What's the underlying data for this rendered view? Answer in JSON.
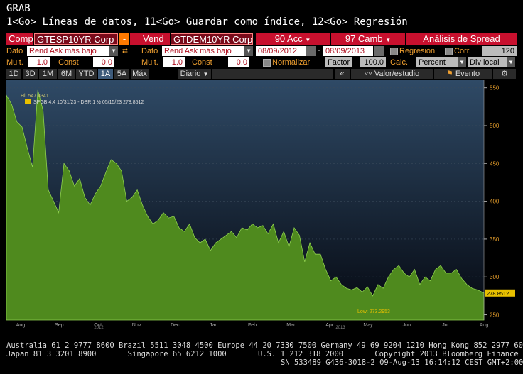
{
  "header": {
    "title": "GRAB",
    "commands": "1<Go> Líneas de datos, 11<Go> Guardar como índice, 12<Go> Regresión"
  },
  "toolbar": {
    "comp_label": "Comp",
    "comp_ticker": "GTESP10YR Corp",
    "minus": "-",
    "vend_label": "Vend",
    "vend_ticker": "GTDEM10YR Corp",
    "acc_label": "90 Acc",
    "camb_label": "97 Camb",
    "analysis_label": "Análisis de Spread"
  },
  "params": {
    "dato_label_1": "Dato",
    "dato_value_1": "Rend Ask más bajo",
    "dato_label_2": "Dato",
    "dato_value_2": "Rend Ask más bajo",
    "date_start": "08/09/2012",
    "date_end": "08/09/2013",
    "regresion": "Regresión",
    "corr": "Corr.",
    "corr_value": "120",
    "mult_label_1": "Mult.",
    "mult_value_1": "1.0",
    "const_label_1": "Const",
    "const_value_1": "0.0",
    "mult_label_2": "Mult.",
    "mult_value_2": "1.0",
    "const_label_2": "Const",
    "const_value_2": "0.0",
    "normalizar": "Normalizar",
    "factor_label": "Factor",
    "factor_value": "100.0",
    "calc_label": "Calc.",
    "calc_value": "Percent",
    "div_value": "Div local"
  },
  "tabs": {
    "items": [
      "1D",
      "3D",
      "1M",
      "6M",
      "YTD",
      "1A",
      "5A",
      "Máx"
    ],
    "active": "1A",
    "period": "Diario",
    "collapse": "«",
    "study": "Valor/estudio",
    "event": "Evento",
    "gear": "gear-icon"
  },
  "chart_data": {
    "type": "area",
    "series": [
      {
        "legend": "SPGB 4.4 10/31/23 - DBR 1 ½ 05/15/23 278.8512",
        "color": "#4f8a1e",
        "x": [
          "2012-08-09",
          "2012-08-13",
          "2012-08-17",
          "2012-08-21",
          "2012-08-25",
          "2012-08-29",
          "2012-09-02",
          "2012-09-06",
          "2012-09-10",
          "2012-09-14",
          "2012-09-18",
          "2012-09-22",
          "2012-09-26",
          "2012-09-30",
          "2012-10-04",
          "2012-10-08",
          "2012-10-12",
          "2012-10-16",
          "2012-10-20",
          "2012-10-24",
          "2012-10-28",
          "2012-11-01",
          "2012-11-05",
          "2012-11-09",
          "2012-11-13",
          "2012-11-17",
          "2012-11-21",
          "2012-11-25",
          "2012-11-29",
          "2012-12-03",
          "2012-12-07",
          "2012-12-11",
          "2012-12-15",
          "2012-12-19",
          "2012-12-23",
          "2012-12-27",
          "2012-12-31",
          "2013-01-04",
          "2013-01-08",
          "2013-01-12",
          "2013-01-16",
          "2013-01-20",
          "2013-01-24",
          "2013-01-28",
          "2013-02-01",
          "2013-02-05",
          "2013-02-09",
          "2013-02-13",
          "2013-02-17",
          "2013-02-21",
          "2013-02-25",
          "2013-03-01",
          "2013-03-05",
          "2013-03-09",
          "2013-03-13",
          "2013-03-17",
          "2013-03-21",
          "2013-03-25",
          "2013-03-29",
          "2013-04-02",
          "2013-04-06",
          "2013-04-10",
          "2013-04-14",
          "2013-04-18",
          "2013-04-22",
          "2013-04-26",
          "2013-04-30",
          "2013-05-04",
          "2013-05-08",
          "2013-05-12",
          "2013-05-16",
          "2013-05-20",
          "2013-05-24",
          "2013-05-28",
          "2013-06-01",
          "2013-06-05",
          "2013-06-09",
          "2013-06-13",
          "2013-06-17",
          "2013-06-21",
          "2013-06-25",
          "2013-06-29",
          "2013-07-03",
          "2013-07-07",
          "2013-07-11",
          "2013-07-15",
          "2013-07-19",
          "2013-07-23",
          "2013-07-27",
          "2013-07-31",
          "2013-08-04",
          "2013-08-09"
        ],
        "values": [
          540,
          528,
          505,
          498,
          470,
          445,
          547,
          520,
          415,
          400,
          385,
          450,
          440,
          420,
          430,
          405,
          395,
          410,
          420,
          438,
          455,
          450,
          440,
          400,
          405,
          415,
          395,
          380,
          370,
          375,
          385,
          378,
          380,
          365,
          360,
          370,
          352,
          345,
          350,
          335,
          345,
          350,
          355,
          360,
          352,
          365,
          362,
          370,
          365,
          368,
          357,
          370,
          345,
          360,
          340,
          365,
          355,
          320,
          345,
          330,
          330,
          310,
          295,
          300,
          290,
          285,
          283,
          286,
          280,
          287,
          275,
          290,
          285,
          300,
          310,
          315,
          305,
          300,
          310,
          290,
          300,
          295,
          310,
          315,
          305,
          305,
          310,
          298,
          290,
          285,
          283,
          279
        ]
      }
    ],
    "xticks": [
      "Aug",
      "Sep",
      "Oct",
      "Nov",
      "Dec",
      "Jan",
      "Feb",
      "Mar",
      "Apr",
      "May",
      "Jun",
      "Jul",
      "Aug"
    ],
    "year_labels": [
      "2012",
      "2013"
    ],
    "yticks": [
      250,
      300,
      350,
      400,
      450,
      500,
      550
    ],
    "ylim": [
      243,
      560
    ],
    "high_label": "Hi: 547.4341",
    "low_label": "Low: 273.2953",
    "last_value": "278.8512",
    "grid": true
  },
  "footer": {
    "line1": "Australia 61 2 9777 8600 Brazil 5511 3048 4500 Europe 44 20 7330 7500 Germany 49 69 9204 1210 Hong Kong 852 2977 6000",
    "line2": "Japan 81 3 3201 8900       Singapore 65 6212 1000       U.S. 1 212 318 2000       Copyright 2013 Bloomberg Finance L.P.",
    "line3": "SN 533489 G436-3018-2 09-Aug-13 16:14:12 CEST GMT+2:00"
  }
}
